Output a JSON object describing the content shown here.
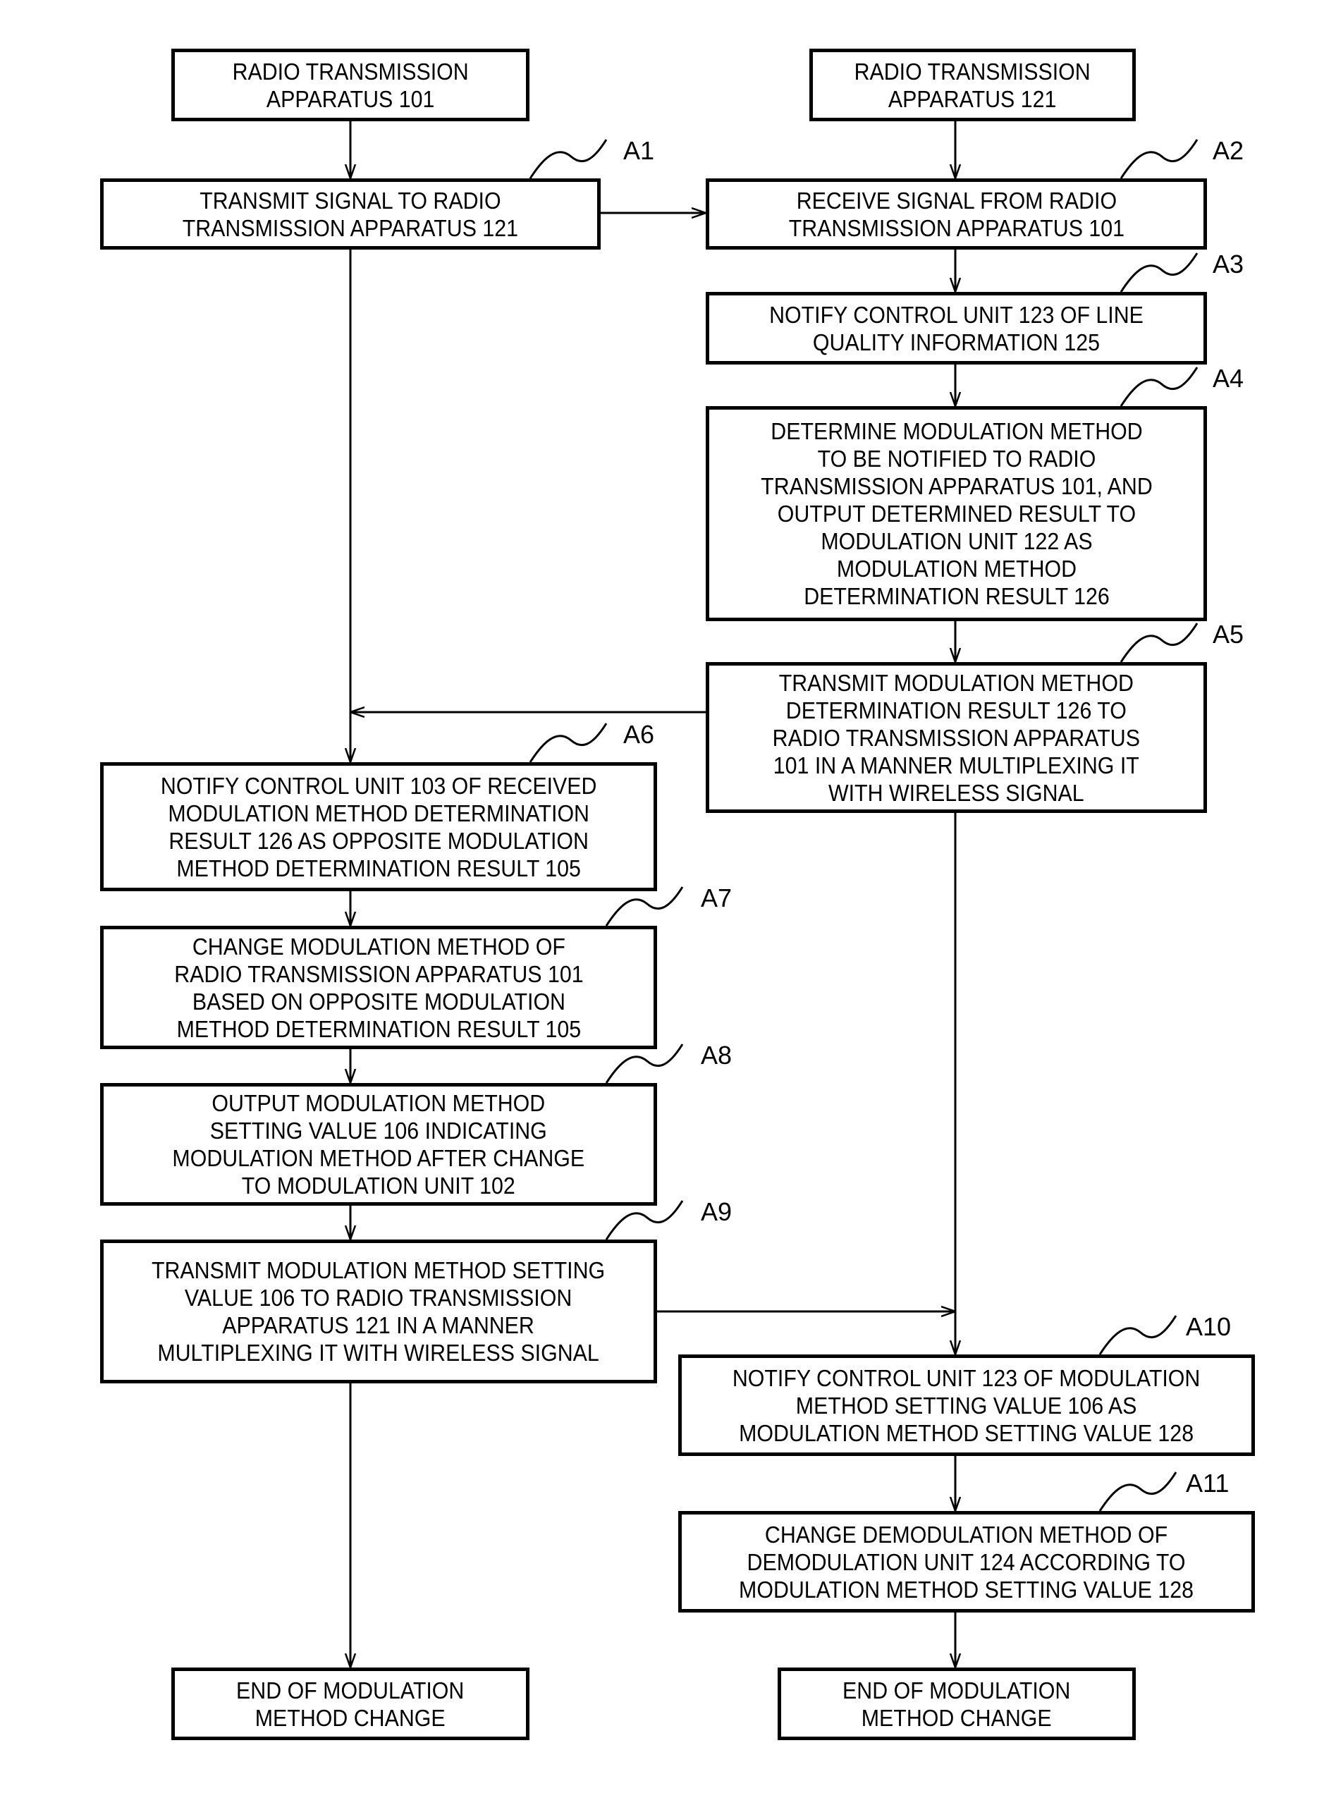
{
  "diagram": {
    "type": "flowchart",
    "columns": [
      {
        "id": "left",
        "title": "RADIO TRANSMISSION\nAPPARATUS 101"
      },
      {
        "id": "right",
        "title": "RADIO TRANSMISSION\nAPPARATUS 121"
      }
    ],
    "steps": [
      {
        "id": "A1",
        "label": "A1",
        "column": "left",
        "text": "TRANSMIT SIGNAL TO RADIO\nTRANSMISSION APPARATUS 121"
      },
      {
        "id": "A2",
        "label": "A2",
        "column": "right",
        "text": "RECEIVE SIGNAL FROM RADIO\nTRANSMISSION APPARATUS 101"
      },
      {
        "id": "A3",
        "label": "A3",
        "column": "right",
        "text": "NOTIFY CONTROL UNIT 123 OF LINE\nQUALITY INFORMATION 125"
      },
      {
        "id": "A4",
        "label": "A4",
        "column": "right",
        "text": "DETERMINE MODULATION METHOD\nTO BE NOTIFIED TO RADIO\nTRANSMISSION APPARATUS 101, AND\nOUTPUT DETERMINED RESULT TO\nMODULATION UNIT 122 AS\nMODULATION METHOD\nDETERMINATION RESULT 126"
      },
      {
        "id": "A5",
        "label": "A5",
        "column": "right",
        "text": "TRANSMIT MODULATION METHOD\nDETERMINATION RESULT 126 TO\nRADIO TRANSMISSION APPARATUS\n101 IN A MANNER MULTIPLEXING IT\nWITH WIRELESS SIGNAL"
      },
      {
        "id": "A6",
        "label": "A6",
        "column": "left",
        "text": "NOTIFY CONTROL UNIT 103 OF RECEIVED\nMODULATION METHOD DETERMINATION\nRESULT 126 AS OPPOSITE MODULATION\nMETHOD DETERMINATION RESULT 105"
      },
      {
        "id": "A7",
        "label": "A7",
        "column": "left",
        "text": "CHANGE MODULATION METHOD OF\nRADIO TRANSMISSION APPARATUS 101\nBASED ON OPPOSITE MODULATION\nMETHOD DETERMINATION RESULT 105"
      },
      {
        "id": "A8",
        "label": "A8",
        "column": "left",
        "text": "OUTPUT MODULATION METHOD\nSETTING VALUE 106 INDICATING\nMODULATION METHOD AFTER CHANGE\nTO MODULATION UNIT 102"
      },
      {
        "id": "A9",
        "label": "A9",
        "column": "left",
        "text": "TRANSMIT MODULATION METHOD SETTING\nVALUE 106 TO RADIO TRANSMISSION\nAPPARATUS 121 IN A MANNER\nMULTIPLEXING IT WITH WIRELESS SIGNAL"
      },
      {
        "id": "A10",
        "label": "A10",
        "column": "right",
        "text": "NOTIFY CONTROL UNIT 123 OF MODULATION\nMETHOD SETTING VALUE 106 AS\nMODULATION METHOD SETTING VALUE 128"
      },
      {
        "id": "A11",
        "label": "A11",
        "column": "right",
        "text": "CHANGE DEMODULATION METHOD OF\nDEMODULATION UNIT 124 ACCORDING TO\nMODULATION METHOD SETTING VALUE 128"
      }
    ],
    "end_left": "END OF MODULATION\nMETHOD CHANGE",
    "end_right": "END OF MODULATION\nMETHOD CHANGE",
    "connections": [
      {
        "from": "start_left",
        "to": "A1"
      },
      {
        "from": "start_right",
        "to": "A2"
      },
      {
        "from": "A1",
        "to": "A2"
      },
      {
        "from": "A2",
        "to": "A3"
      },
      {
        "from": "A3",
        "to": "A4"
      },
      {
        "from": "A4",
        "to": "A5"
      },
      {
        "from": "A5",
        "to": "A6"
      },
      {
        "from": "A1",
        "to": "A6"
      },
      {
        "from": "A6",
        "to": "A7"
      },
      {
        "from": "A7",
        "to": "A8"
      },
      {
        "from": "A8",
        "to": "A9"
      },
      {
        "from": "A9",
        "to": "A10"
      },
      {
        "from": "A5",
        "to": "A10"
      },
      {
        "from": "A10",
        "to": "A11"
      },
      {
        "from": "A9",
        "to": "end_left"
      },
      {
        "from": "A11",
        "to": "end_right"
      }
    ]
  }
}
